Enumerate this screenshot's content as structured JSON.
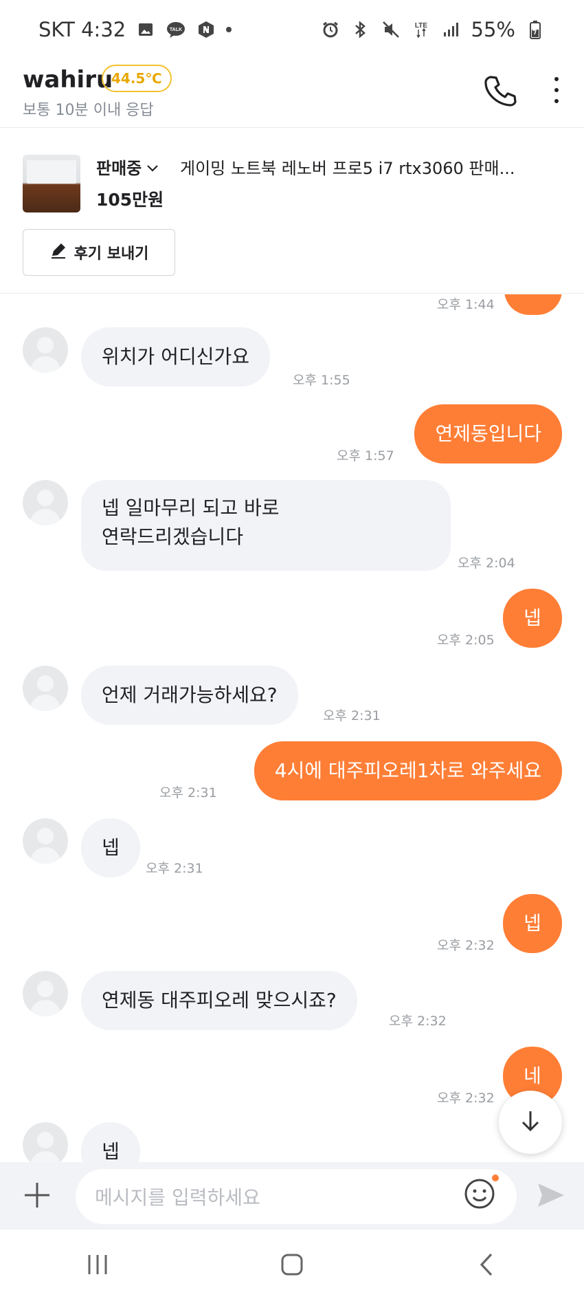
{
  "status_bar": {
    "carrier_time": "SKT 4:32",
    "battery": "55%",
    "network": "LTE"
  },
  "header": {
    "user_name": "wahiru",
    "temperature": "44.5℃",
    "response_time": "보통 10분 이내 응답"
  },
  "product": {
    "state": "판매중",
    "title": "게이밍 노트북 레노버 프로5 i7 rtx3060 판매...",
    "price": "105만원",
    "review_button": "후기 보내기"
  },
  "messages": [
    {
      "id": "m0",
      "side": "out",
      "text": "",
      "time": "오후 1:44"
    },
    {
      "id": "m1",
      "side": "in",
      "text": "위치가 어디신가요",
      "time": "오후 1:55"
    },
    {
      "id": "m2",
      "side": "out",
      "text": "연제동입니다",
      "time": "오후 1:57"
    },
    {
      "id": "m3",
      "side": "in",
      "lines": [
        "넵 일마무리 되고 바로",
        "연락드리겠습니다"
      ],
      "time": "오후 2:04"
    },
    {
      "id": "m4",
      "side": "out",
      "text": "넵",
      "time": "오후 2:05"
    },
    {
      "id": "m5",
      "side": "in",
      "text": "언제 거래가능하세요?",
      "time": "오후 2:31"
    },
    {
      "id": "m6",
      "side": "out",
      "text": "4시에 대주피오레1차로 와주세요",
      "time": "오후 2:31"
    },
    {
      "id": "m7",
      "side": "in",
      "text": "넵",
      "time": "오후 2:31"
    },
    {
      "id": "m8",
      "side": "out",
      "text": "넵",
      "time": "오후 2:32"
    },
    {
      "id": "m9",
      "side": "in",
      "text": "연제동 대주피오레 맞으시죠?",
      "time": "오후 2:32"
    },
    {
      "id": "m10",
      "side": "out",
      "text": "네",
      "time": "오후 2:32"
    },
    {
      "id": "m11",
      "side": "in",
      "text": "넵",
      "time": ""
    }
  ],
  "input": {
    "placeholder": "메시지를 입력하세요"
  },
  "colors": {
    "accent": "#ff7e36",
    "incoming_bubble": "#f2f3f6",
    "time_text": "#999ca1",
    "temp_badge": "#e8a800"
  },
  "icons": {
    "call": "phone-icon",
    "more": "more-vertical-icon",
    "pencil": "pencil-icon",
    "plus": "plus-icon",
    "emoji": "emoji-icon",
    "send": "send-icon",
    "scroll_down": "arrow-down-icon",
    "nav_recent": "recent-apps-icon",
    "nav_home": "home-icon",
    "nav_back": "back-icon"
  }
}
